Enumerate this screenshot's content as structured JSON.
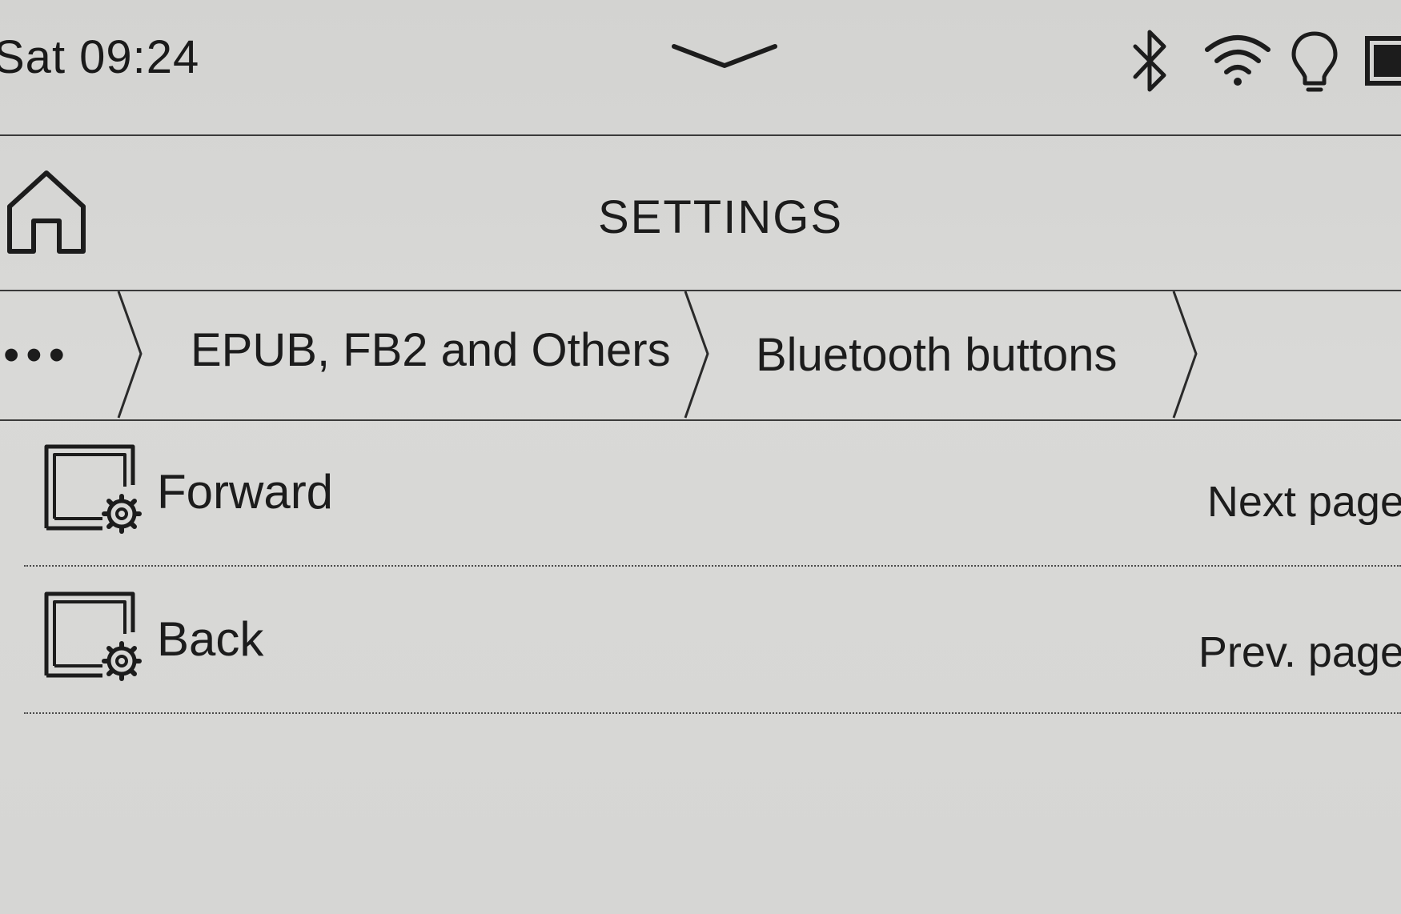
{
  "status_bar": {
    "time": "Sat 09:24",
    "icons": [
      "bluetooth-icon",
      "wifi-icon",
      "frontlight-icon",
      "battery-icon"
    ]
  },
  "header": {
    "title": "SETTINGS",
    "home_icon": "home-icon"
  },
  "breadcrumb": {
    "more": "•••",
    "items": [
      {
        "label": "EPUB, FB2 and Others"
      },
      {
        "label": "Bluetooth buttons"
      }
    ]
  },
  "list": {
    "rows": [
      {
        "label": "Forward",
        "value": "Next page",
        "icon": "reader-settings-icon"
      },
      {
        "label": "Back",
        "value": "Prev. page",
        "icon": "reader-settings-icon"
      }
    ]
  },
  "colors": {
    "background": "#d6d6d4",
    "ink": "#1c1c1c"
  }
}
